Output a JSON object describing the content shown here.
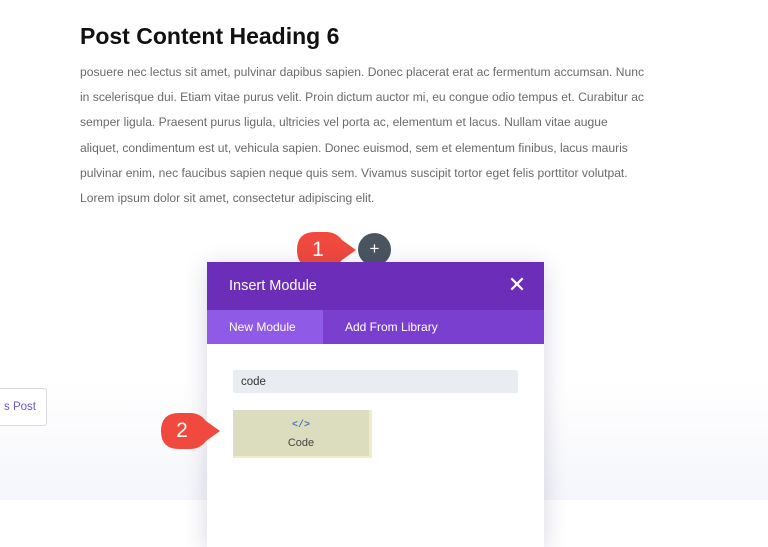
{
  "post": {
    "heading": "Post Content Heading 6",
    "lines": [
      "posuere nec lectus sit amet, pulvinar dapibus sapien. Donec placerat erat ac fermentum accumsan. Nunc",
      "in scelerisque dui. Etiam vitae purus velit. Proin dictum auctor mi, eu congue odio tempus et. Curabitur ac",
      "semper ligula. Praesent purus ligula, ultricies vel porta ac, elementum et lacus. Nullam vitae augue",
      "aliquet, condimentum est ut, vehicula sapien. Donec euismod, sem et elementum finibus, lacus mauris",
      "pulvinar enim, nec faucibus sapien neque quis sem. Vivamus suscipit tortor eget felis porttitor volutpat.",
      "Lorem ipsum dolor sit amet, consectetur adipiscing elit."
    ]
  },
  "post_nav": {
    "prev_label": "s Post"
  },
  "add_button": {
    "icon": "plus-icon",
    "glyph": "+"
  },
  "callouts": {
    "first": "1",
    "second": "2",
    "color": "#f0493e"
  },
  "modal": {
    "title": "Insert Module",
    "close_glyph": "✕",
    "tabs": {
      "new_module": "New Module",
      "from_library": "Add From Library"
    },
    "search": {
      "value": "code",
      "placeholder": ""
    },
    "modules": [
      {
        "icon": "code-icon",
        "icon_glyph": "</>",
        "label": "Code"
      }
    ],
    "colors": {
      "header": "#6c2eb9",
      "tabs": "#7b3fd0",
      "active_tab": "#8f5be6"
    }
  }
}
